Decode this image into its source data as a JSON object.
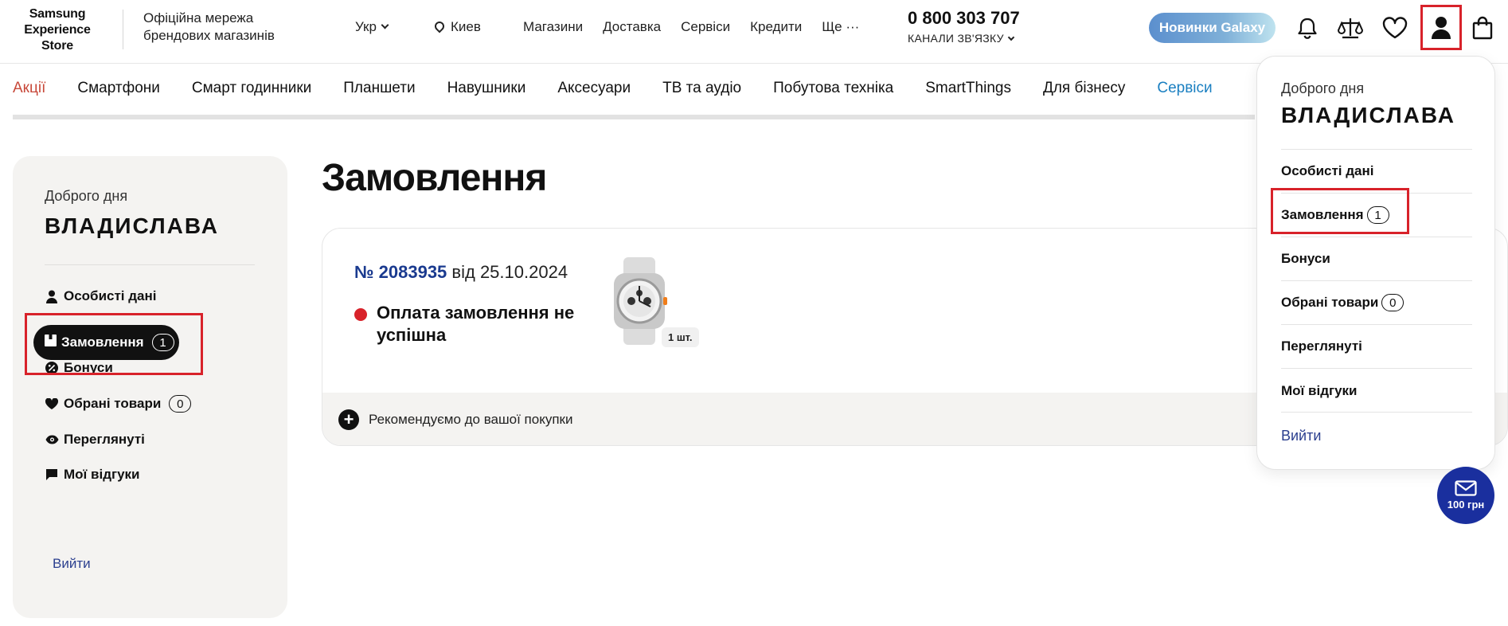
{
  "header": {
    "logo": [
      "Samsung",
      "Experience",
      "Store"
    ],
    "tagline": "Офіційна мережа брендових магазинів",
    "lang": "Укр",
    "city": "Киев",
    "nav": [
      "Магазини",
      "Доставка",
      "Сервіси",
      "Кредити",
      "Ще ···"
    ],
    "phone": "0 800 303 707",
    "channels": "КАНАЛИ ЗВ'ЯЗКУ",
    "galaxy_button": "Новинки Galaxy",
    "icons": [
      "bell-icon",
      "compare-scales-icon",
      "heart-icon",
      "user-icon",
      "shopping-bag-icon"
    ]
  },
  "categories": [
    "Акції",
    "Смартфони",
    "Смарт годинники",
    "Планшети",
    "Навушники",
    "Аксесуари",
    "ТВ та аудіо",
    "Побутова техніка",
    "SmartThings",
    "Для бізнесу",
    "Сервіси"
  ],
  "sidebar": {
    "greeting": "Доброго дня",
    "name": "ВЛАДИСЛАВА",
    "items": [
      {
        "label": "Особисті дані",
        "icon": "person-icon"
      },
      {
        "label": "Замовлення",
        "icon": "box-icon",
        "count": "1",
        "active": true
      },
      {
        "label": "Бонуси",
        "icon": "percent-icon"
      },
      {
        "label": "Обрані товари",
        "icon": "heart-icon",
        "count": "0"
      },
      {
        "label": "Переглянуті",
        "icon": "eye-icon"
      },
      {
        "label": "Мої відгуки",
        "icon": "comment-icon"
      }
    ],
    "logout": "Вийти"
  },
  "main": {
    "title": "Замовлення",
    "order": {
      "number": "№ 2083935",
      "date_text": "від 25.10.2024",
      "status": "Оплата замовлення не успішна",
      "status_color": "#d8222a",
      "quantity": "1 шт."
    },
    "recommend": "Рекомендуємо до вашої покупки"
  },
  "dropdown": {
    "greeting": "Доброго дня",
    "name": "ВЛАДИСЛАВА",
    "items": [
      {
        "label": "Особисті дані"
      },
      {
        "label": "Замовлення",
        "count": "1"
      },
      {
        "label": "Бонуси"
      },
      {
        "label": "Обрані товари",
        "count": "0"
      },
      {
        "label": "Переглянуті"
      },
      {
        "label": "Мої відгуки"
      }
    ],
    "logout": "Вийти"
  },
  "bubble": {
    "label": "100 грн",
    "icon": "mail-icon"
  },
  "colors": {
    "highlight": "#d8222a",
    "link": "#2b3f8f",
    "promo": "#c8493a",
    "service": "#1a7fc1"
  }
}
